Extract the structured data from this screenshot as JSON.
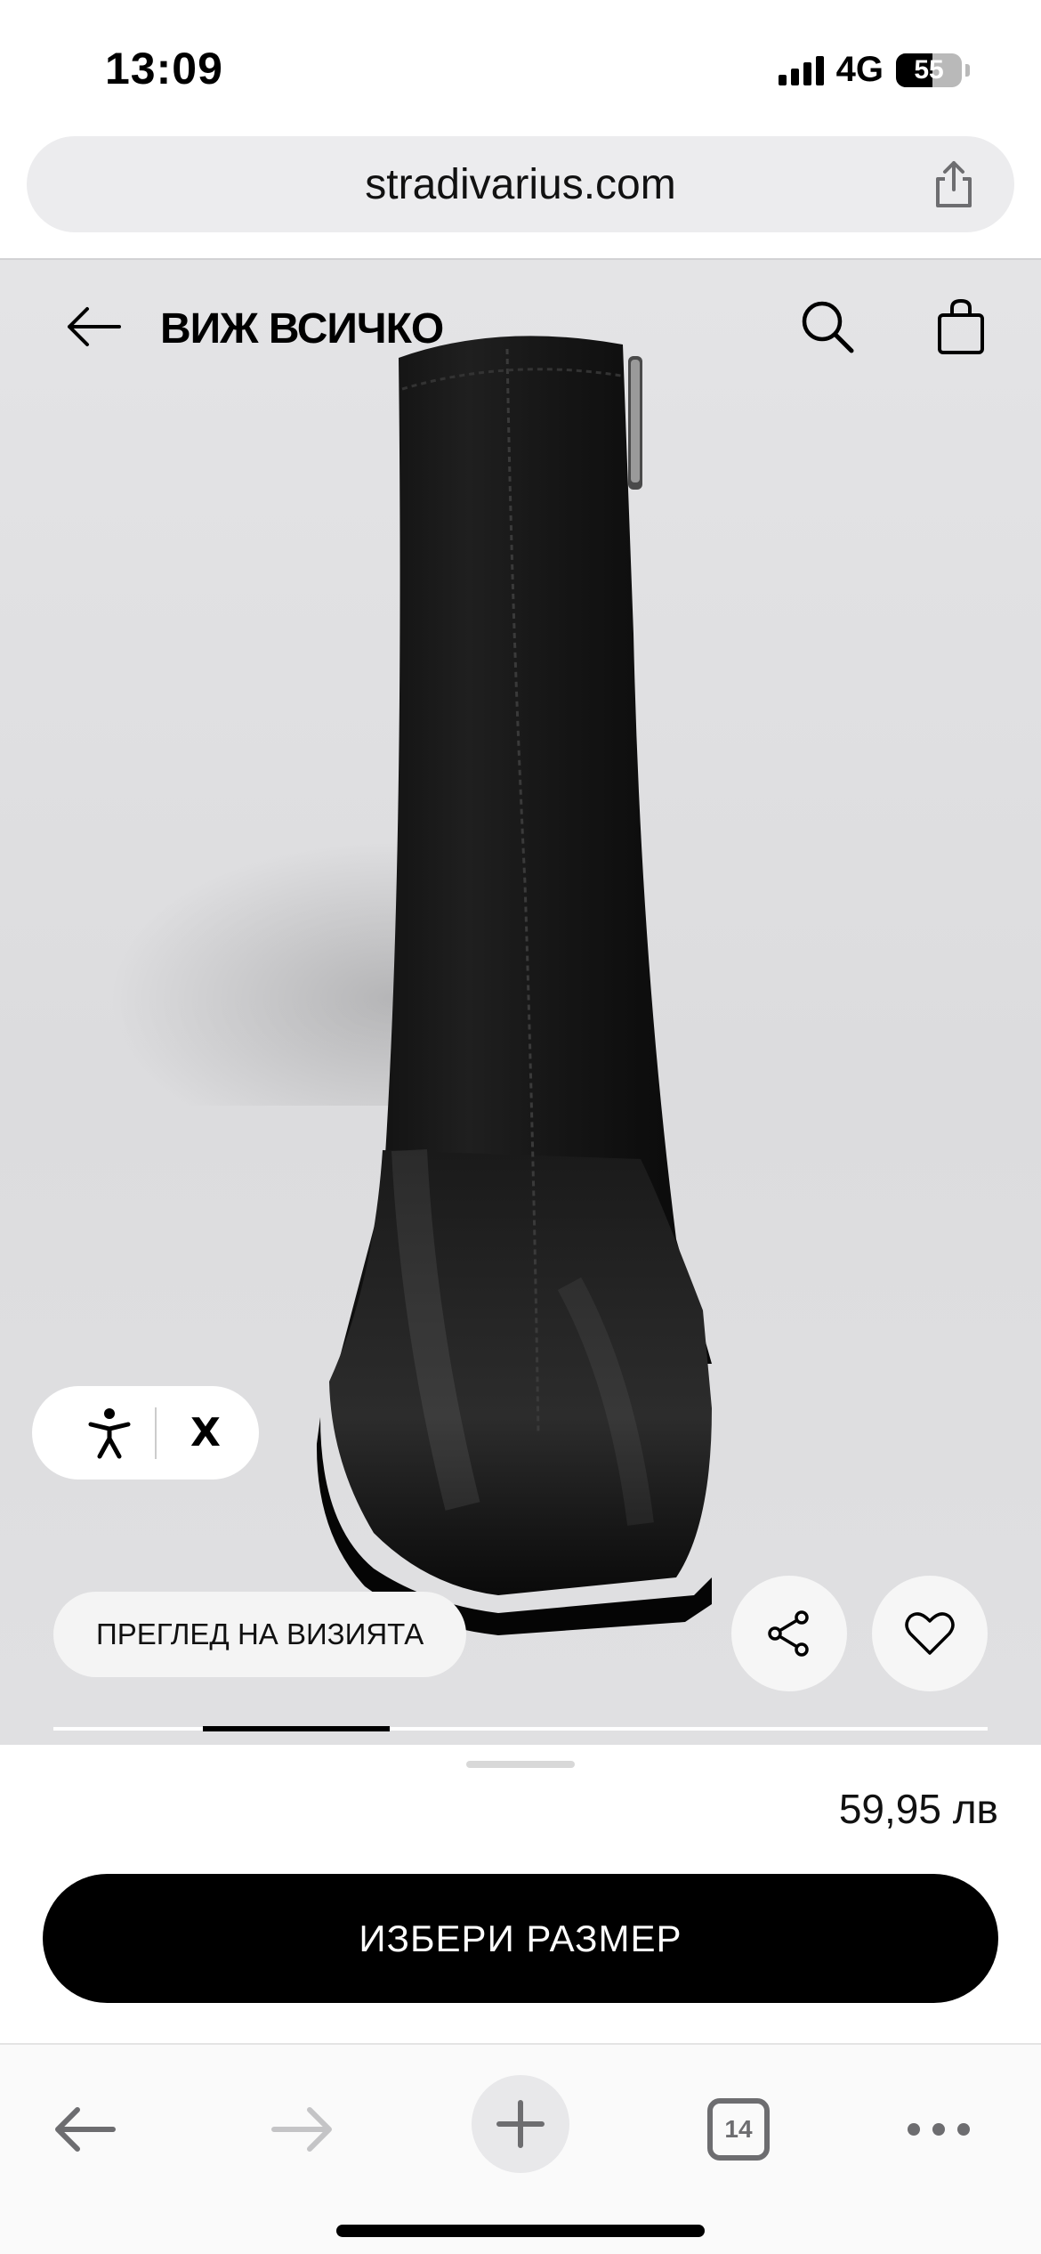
{
  "status_bar": {
    "time": "13:09",
    "network": "4G",
    "battery": "55",
    "battery_level": 0.55,
    "signal_icon": "cellular-signal-icon"
  },
  "browser": {
    "url": "stradivarius.com",
    "share_icon": "share-icon",
    "tab_count": "14",
    "toolbar_icons": [
      "back-arrow-icon",
      "forward-arrow-icon",
      "plus-icon",
      "tabs-icon",
      "more-icon"
    ]
  },
  "product_page": {
    "header": {
      "back_icon": "arrow-left-icon",
      "title": "ВИЖ ВСИЧКО",
      "search_icon": "search-icon",
      "bag_icon": "shopping-bag-icon"
    },
    "accessibility": {
      "icon": "accessibility-icon",
      "close": "X"
    },
    "visit_label": "ПРЕГЛЕД НА ВИЗИЯТА",
    "actions": {
      "share_icon": "share-nodes-icon",
      "favorite_icon": "heart-icon"
    },
    "gallery_position": 0.2
  },
  "sheet": {
    "price": "59,95 лв",
    "cta_label": "ИЗБЕРИ РАЗМЕР"
  },
  "colors": {
    "background_photo": "#e0e0e2",
    "accent": "#000000",
    "cta_text": "#ffffff"
  }
}
